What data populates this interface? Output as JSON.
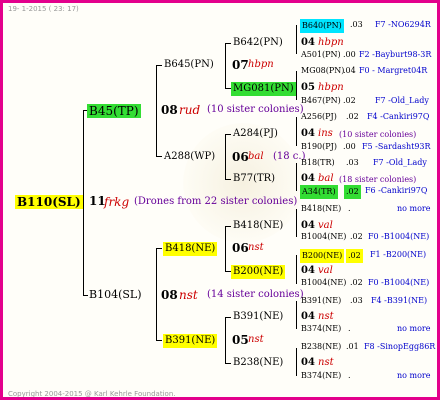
{
  "header": {
    "date": "19-  1-2015 ( 23: 17)"
  },
  "footer": {
    "copyright": "Copyright 2004-2015 @ Karl Kehrle Foundation."
  },
  "colors": {
    "frame": "#e3008c",
    "green": "#33dd33",
    "yellow": "#ffff00",
    "cyan": "#00e5ff",
    "blue": "#0000cc",
    "red": "#cc0000",
    "purple": "#660099"
  },
  "root": {
    "id": "B110(SL)",
    "year": "11",
    "race": "frkg",
    "note": "(Drones from 22 sister colonies)"
  },
  "g1": {
    "top": {
      "id": "B45(TP)",
      "year": "08",
      "race": "rud",
      "note": "(10 sister colonies)"
    },
    "bottom": {
      "id": "B104(SL)",
      "year": "08",
      "race": "nst",
      "note": "(14 sister colonies)"
    }
  },
  "g2": {
    "a": {
      "id": "B645(PN)",
      "year": "07",
      "race": "hbpn"
    },
    "b": {
      "id": "A288(WP)",
      "year": "06",
      "race": "bal",
      "note": "(18 c.)"
    },
    "c": {
      "id": "B418(NE)",
      "year": "06",
      "race": "nst"
    },
    "d": {
      "id": "B391(NE)",
      "year": "05",
      "race": "nst"
    }
  },
  "g3": {
    "a1": {
      "id": "B642(PN)",
      "year": "04",
      "race": "hbpn"
    },
    "a2": {
      "id": "MG081(PN)",
      "year": "05",
      "race": "hbpn"
    },
    "b1": {
      "id": "A284(PJ)",
      "year": "04",
      "race": "ins",
      "note": "(10 sister colonies)"
    },
    "b2": {
      "id": "B77(TR)",
      "year": "04",
      "race": "bal",
      "note": "(18 sister colonies)"
    },
    "c1": {
      "id": "B418(NE)",
      "year": "04",
      "race": "val"
    },
    "c2": {
      "id": "B200(NE)",
      "year": "04",
      "race": "val"
    },
    "d1": {
      "id": "B391(NE)",
      "year": "04",
      "race": "nst"
    },
    "d2": {
      "id": "B238(NE)",
      "year": "04",
      "race": "nst"
    }
  },
  "g4": [
    {
      "id": "B640(PN)",
      "year": ".03",
      "info": "F7 -NO6294R"
    },
    {
      "id": "A501(PN)",
      "year": ".00",
      "info": "F2 -Bayburt98-3R"
    },
    {
      "id": "MG08(PN)",
      "year": ".04",
      "info": "F0 - Margret04R"
    },
    {
      "id": "B467(PN)",
      "year": ".02",
      "info": "F7 -Old_Lady"
    },
    {
      "id": "A256(PJ)",
      "year": ".02",
      "info": "F4 -Cankiri97Q"
    },
    {
      "id": "B190(PJ)",
      "year": ".00",
      "info": "F5 -Sardasht93R"
    },
    {
      "id": "B18(TR)",
      "year": ".03",
      "info": "F7 -Old_Lady"
    },
    {
      "id": "A34(TR)",
      "year": ".02",
      "info": "F6 -Cankiri97Q"
    },
    {
      "id": "B418(NE)",
      "year": ".",
      "info": "no more"
    },
    {
      "id": "B1004(NE)",
      "year": ".02",
      "info": "F0 -B1004(NE)"
    },
    {
      "id": "B200(NE)",
      "year": ".02",
      "info": "F1 -B200(NE)"
    },
    {
      "id": "B1004(NE)",
      "year": ".02",
      "info": "F0 -B1004(NE)"
    },
    {
      "id": "B391(NE)",
      "year": ".03",
      "info": "F4 -B391(NE)"
    },
    {
      "id": "B374(NE)",
      "year": ".",
      "info": "no more"
    },
    {
      "id": "B238(NE)",
      "year": ".01",
      "info": "F8 -SinopEgg86R"
    },
    {
      "id": "B374(NE)",
      "year": ".",
      "info": "no more"
    }
  ]
}
